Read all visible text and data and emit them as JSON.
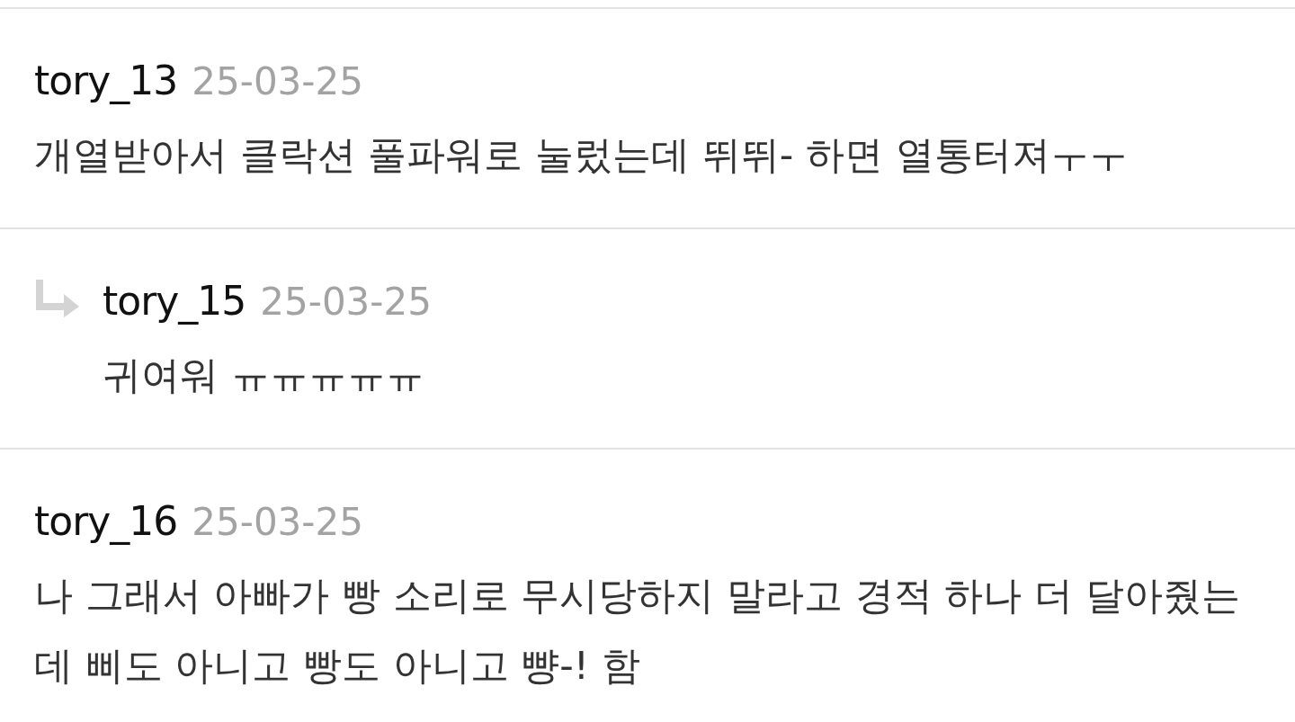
{
  "comments": [
    {
      "kind": "comment",
      "author": "tory_13",
      "date": "25-03-25",
      "text": "개열받아서 클락션 풀파워로 눌렀는데 뛰뛰- 하면 열통터져ㅜㅜ"
    },
    {
      "kind": "reply",
      "author": "tory_15",
      "date": "25-03-25",
      "text": "귀여워 ㅠㅠㅠㅠㅠ"
    },
    {
      "kind": "comment",
      "author": "tory_16",
      "date": "25-03-25",
      "text": "나 그래서 아빠가 빵 소리로 무시당하지 말라고 경적 하나 더 달아줬는데 삐도 아니고 빵도 아니고 뺭-! 함"
    }
  ]
}
